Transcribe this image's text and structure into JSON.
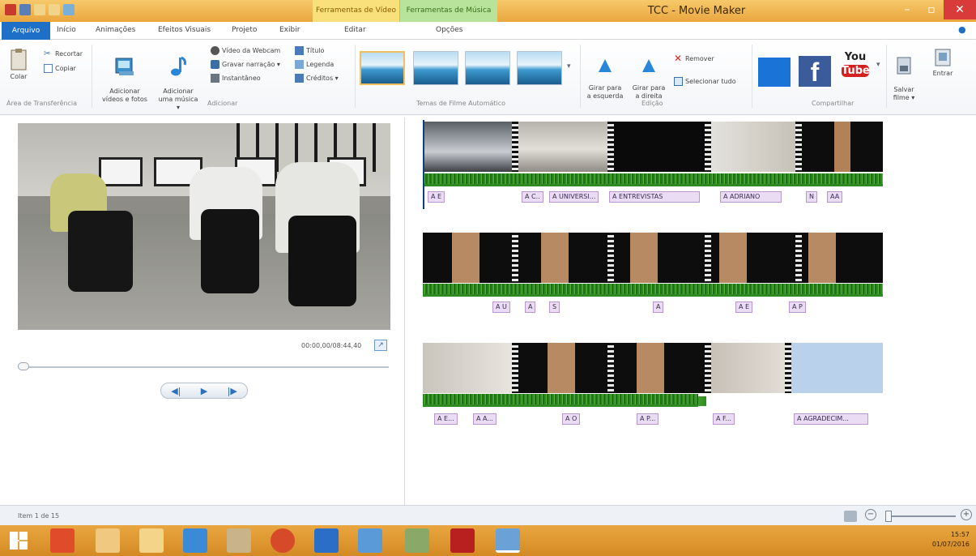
{
  "window": {
    "title": "TCC - Movie Maker",
    "ctx_video": "Ferramentas de Vídeo",
    "ctx_music": "Ferramentas de Música",
    "minimize": "–",
    "maximize": "▫",
    "close": "✕"
  },
  "tabs": {
    "file": "Arquivo",
    "home": "Início",
    "animations": "Animações",
    "visual_effects": "Efeitos Visuais",
    "project": "Projeto",
    "view": "Exibir",
    "edit": "Editar",
    "options": "Opções"
  },
  "ribbon": {
    "paste": "Colar",
    "cut": "Recortar",
    "copy": "Copiar",
    "add_videos": "Adicionar\nvídeos e fotos",
    "add_music": "Adicionar\numa música ▾",
    "webcam": "Vídeo da Webcam",
    "narration": "Gravar narração ▾",
    "snapshot": "Instantâneo",
    "title": "Título",
    "caption": "Legenda",
    "credits": "Créditos ▾",
    "rotate_left": "Girar para\na esquerda",
    "rotate_right": "Girar para\na direita",
    "remove": "Remover",
    "select_all": "Selecionar tudo",
    "save_movie": "Salvar\nfilme ▾",
    "sign_in": "Entrar",
    "group_clipboard": "Área de Transferência",
    "group_add": "Adicionar",
    "group_themes": "Temas de Filme Automático",
    "group_edit": "Edição",
    "group_share": "Compartilhar",
    "youtube_top": "You",
    "youtube_bottom": "Tube",
    "facebook": "f"
  },
  "preview": {
    "timecode": "00:00,00/08:44,40",
    "expand": "↗",
    "prev_frame": "◀|",
    "play": "▶",
    "next_frame": "|▶"
  },
  "captions": {
    "row1": [
      "A E",
      "A C..",
      "A UNIVERSI...",
      "A ENTREVISTAS",
      "A ADRIANO",
      "N",
      "AA"
    ],
    "row2": [
      "A U",
      "A",
      "S",
      "A",
      "A E",
      "A P"
    ],
    "row3": [
      "A E...",
      "A A...",
      "A O",
      "A P...",
      "A F...",
      "A AGRADECIM..."
    ]
  },
  "status": {
    "item": "Item 1 de 15"
  },
  "tray": {
    "time": "15:57",
    "date": "01/07/2016"
  },
  "colors": {
    "titlebar": "#e9a63e",
    "file_tab": "#1e6fc8",
    "caption_bg": "#eadcf2",
    "audio": "#2e8a22"
  }
}
